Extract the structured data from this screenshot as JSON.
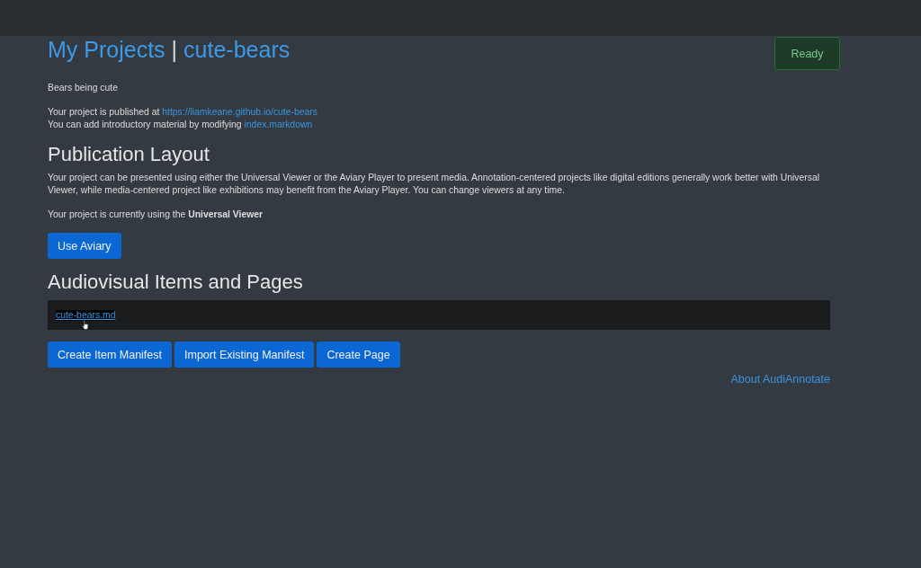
{
  "header": {
    "title": {
      "home_link": "My Projects",
      "separator": "|",
      "project_link": "cute-bears"
    },
    "status_badge": "Ready"
  },
  "project": {
    "description": "Bears being cute",
    "info_lines": [
      {
        "text": "Your project is published at",
        "link": "https://liamkeane.github.io/cute-bears"
      },
      {
        "text": "You can add introductory material by modifying",
        "link": "index.markdown"
      }
    ]
  },
  "publication_layout": {
    "heading": "Publication Layout",
    "paragraph": "Your project can be presented using either the Universal Viewer or the Aviary Player to present media. Annotation-centered projects like digital editions generally work better with Universal Viewer, while media-centered project like exhibitions may benefit from the Aviary Player. You can change viewers at any time.",
    "current_viewer": "Your project is currently using the **Universal Viewer**",
    "button": "Use Aviary"
  },
  "items_section": {
    "heading": "Audiovisual Items and Pages",
    "items": [
      {
        "label": "cute-bears.md",
        "selected": true
      }
    ],
    "buttons": [
      "Create Item Manifest",
      "Import Existing Manifest",
      "Create Page"
    ]
  },
  "footer_link": "About AudiAnnotate"
}
